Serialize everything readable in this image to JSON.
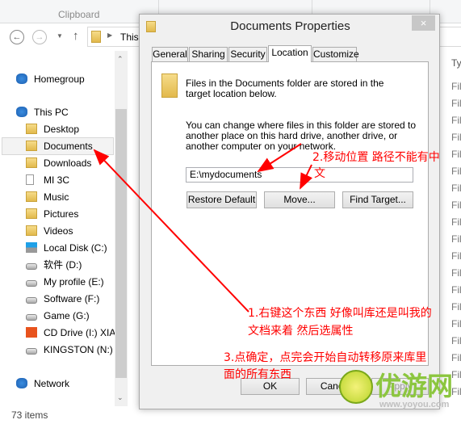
{
  "ribbon": {
    "clipboard_label": "Clipboard"
  },
  "address": {
    "path_label": "This"
  },
  "nav": {
    "items": [
      {
        "label": "Homegroup",
        "icon": "homegroup-icon"
      },
      {
        "label": "This PC",
        "icon": "computer-icon"
      },
      {
        "label": "Desktop",
        "icon": "folder-desktop-icon"
      },
      {
        "label": "Documents",
        "icon": "folder-documents-icon"
      },
      {
        "label": "Downloads",
        "icon": "folder-downloads-icon"
      },
      {
        "label": "MI 3C",
        "icon": "phone-icon"
      },
      {
        "label": "Music",
        "icon": "folder-music-icon"
      },
      {
        "label": "Pictures",
        "icon": "folder-pictures-icon"
      },
      {
        "label": "Videos",
        "icon": "folder-videos-icon"
      },
      {
        "label": "Local Disk (C:)",
        "icon": "windows-drive-icon"
      },
      {
        "label": "软件 (D:)",
        "icon": "drive-icon"
      },
      {
        "label": "My profile (E:)",
        "icon": "drive-icon"
      },
      {
        "label": "Software (F:)",
        "icon": "drive-icon"
      },
      {
        "label": "Game (G:)",
        "icon": "drive-icon"
      },
      {
        "label": "CD Drive (I:) XIAO",
        "icon": "mi-icon"
      },
      {
        "label": "KINGSTON (N:)",
        "icon": "usb-drive-icon"
      },
      {
        "label": "Network",
        "icon": "network-icon"
      }
    ]
  },
  "status": {
    "items_count": "73 items"
  },
  "list": {
    "type_header": "Ty",
    "row_text": "Fil"
  },
  "dialog": {
    "title": "Documents Properties",
    "close": "×",
    "tabs": [
      "General",
      "Sharing",
      "Security",
      "Location",
      "Customize"
    ],
    "active_tab": "Location",
    "text1": "Files in the Documents folder are stored in the target location below.",
    "text2": "You can change where files in this folder are stored to another place on this hard drive, another drive, or another computer on your network.",
    "path_value": "E:\\mydocuments",
    "restore_default": "Restore Default",
    "move": "Move...",
    "find_target": "Find Target...",
    "ok": "OK",
    "cancel": "Cancel",
    "apply": "Apply"
  },
  "annotations": {
    "a1_line1": "1.右键这个东西 好像叫库还是叫我的",
    "a1_line2": "文档来着  然后选属性",
    "a2_line1": "2.移动位置 路径不能有中",
    "a2_line2": "文",
    "a3_line1": "3.点确定，点完会开始自动转移原来库里",
    "a3_line2": "面的所有东西",
    "color": "#ff0000"
  },
  "watermark": {
    "brand": "优游网",
    "url": "www.yoyou.com"
  }
}
